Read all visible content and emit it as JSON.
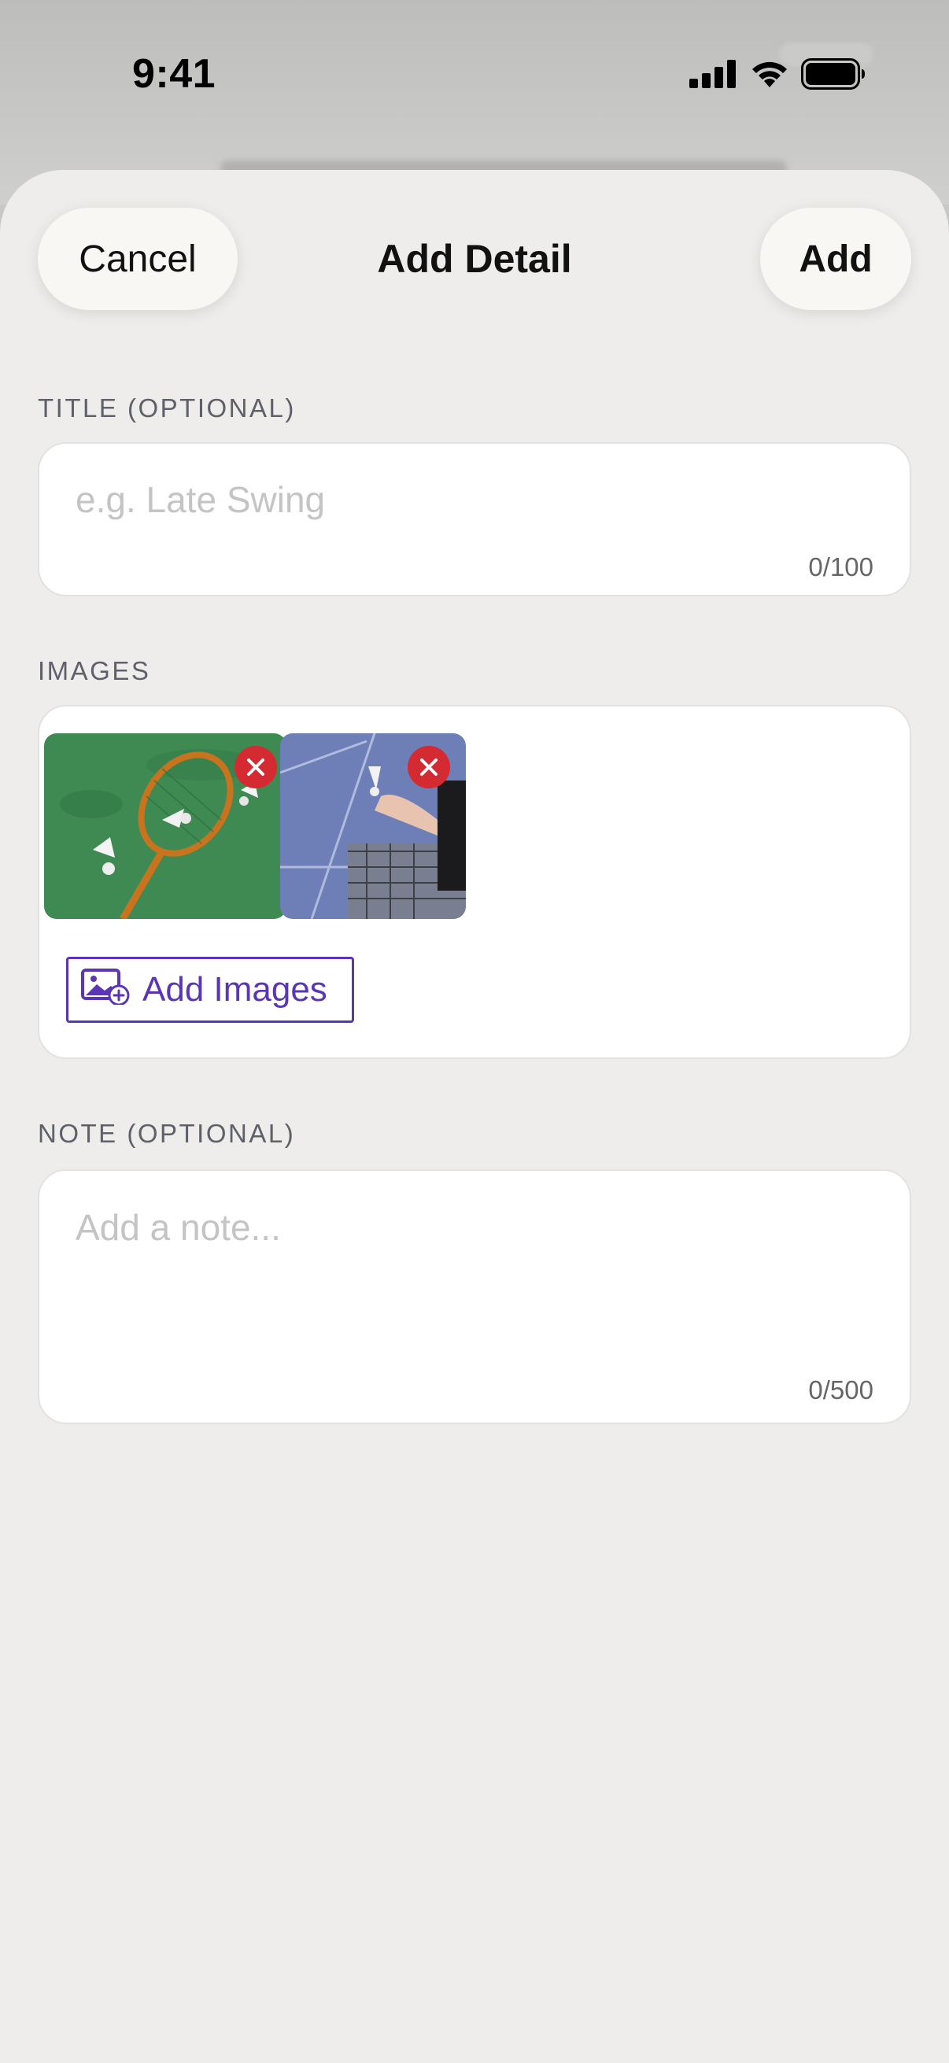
{
  "status_bar": {
    "time": "9:41"
  },
  "header": {
    "title": "Add Detail",
    "cancel_label": "Cancel",
    "add_label": "Add"
  },
  "title_field": {
    "label": "TITLE (OPTIONAL)",
    "placeholder": "e.g. Late Swing",
    "value": "",
    "counter": "0/100"
  },
  "images_section": {
    "label": "IMAGES",
    "add_button_label": "Add Images",
    "thumbnails": [
      {
        "name": "racket-and-shuttlecocks",
        "remove_icon": "close-icon"
      },
      {
        "name": "shuttlecock-at-net",
        "remove_icon": "close-icon"
      }
    ]
  },
  "note_field": {
    "label": "NOTE (OPTIONAL)",
    "placeholder": "Add a note...",
    "value": "",
    "counter": "0/500"
  },
  "colors": {
    "accent": "#5a36b5",
    "remove": "#d42b33",
    "sheet": "#eeedeb"
  }
}
